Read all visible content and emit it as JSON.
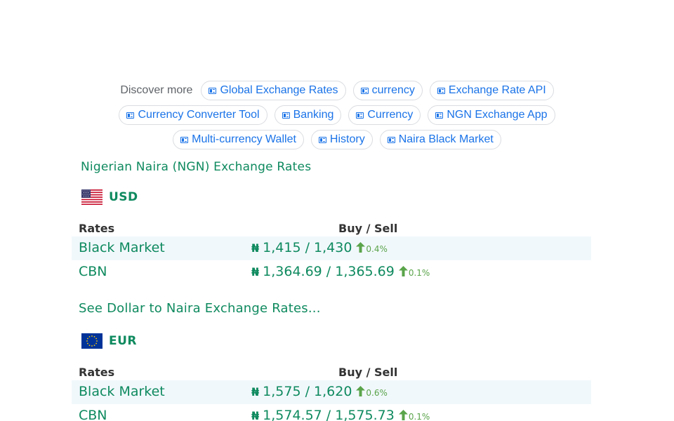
{
  "discover": {
    "label": "Discover more",
    "rows": [
      [
        "Global Exchange Rates",
        "currency",
        "Exchange Rate API"
      ],
      [
        "Currency Converter Tool",
        "Banking",
        "Currency",
        "NGN Exchange App"
      ],
      [
        "Multi-currency Wallet",
        "History",
        "Naira Black Market"
      ]
    ]
  },
  "page_title": "Nigerian Naira (NGN) Exchange Rates",
  "sections": [
    {
      "code": "USD",
      "flag_icon": "us-flag-icon",
      "headers": {
        "rates": "Rates",
        "buy_sell": "Buy / Sell"
      },
      "rows": [
        {
          "name": "Black Market",
          "symbol": "₦",
          "value": "1,415 / 1,430",
          "change": "0.4%"
        },
        {
          "name": "CBN",
          "symbol": "₦",
          "value": "1,364.69 / 1,365.69",
          "change": "0.1%"
        }
      ],
      "see_more": "See Dollar to Naira Exchange Rates..."
    },
    {
      "code": "EUR",
      "flag_icon": "eu-flag-icon",
      "headers": {
        "rates": "Rates",
        "buy_sell": "Buy / Sell"
      },
      "rows": [
        {
          "name": "Black Market",
          "symbol": "₦",
          "value": "1,575 / 1,620",
          "change": "0.6%"
        },
        {
          "name": "CBN",
          "symbol": "₦",
          "value": "1,574.57 / 1,575.73",
          "change": "0.1%"
        }
      ]
    }
  ],
  "colors": {
    "accent_green": "#0f8a5f",
    "chip_blue": "#1a73e8",
    "up_green": "#5aa44a",
    "row_shade": "#f1f8fc"
  }
}
